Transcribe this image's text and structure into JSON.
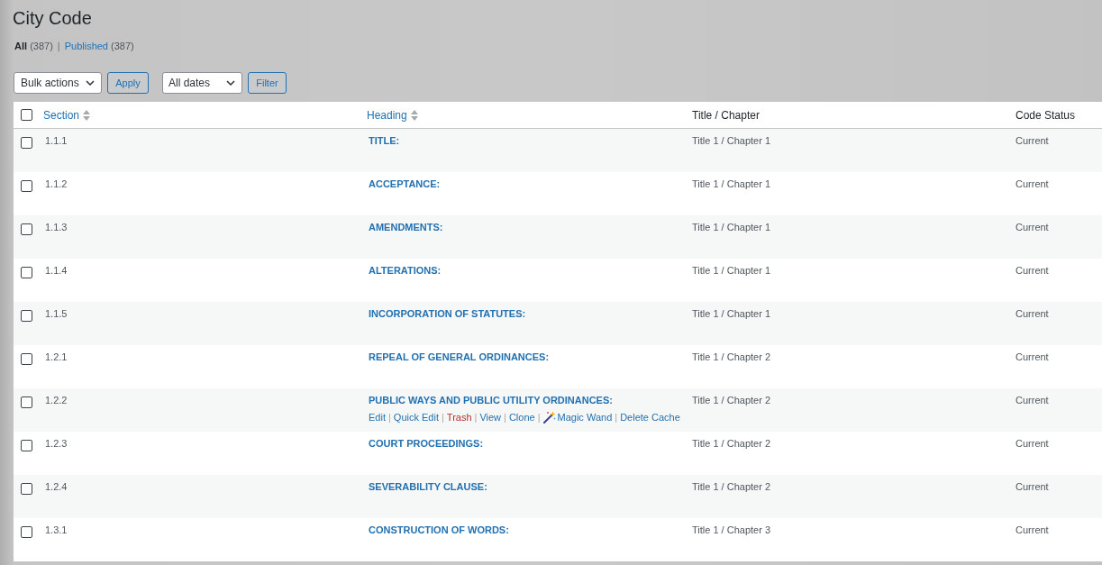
{
  "page": {
    "title": "City Code"
  },
  "filters": {
    "separator": "|",
    "items": [
      {
        "label": "All",
        "count": "(387)",
        "selected": true
      },
      {
        "label": "Published",
        "count": "(387)",
        "selected": false
      }
    ]
  },
  "toolbar": {
    "bulk_actions": {
      "value": "Bulk actions"
    },
    "apply_button": "Apply",
    "date_filter": {
      "value": "All dates"
    },
    "filter_button": "Filter"
  },
  "table": {
    "select_all_checked": false,
    "columns": [
      {
        "label": "Section",
        "sortable": true
      },
      {
        "label": "Heading",
        "sortable": true
      },
      {
        "label": "Title / Chapter",
        "sortable": false
      },
      {
        "label": "Code Status",
        "sortable": false
      }
    ],
    "rows": [
      {
        "checked": false,
        "section": "1.1.1",
        "heading": "TITLE:",
        "title_chapter": "Title 1 / Chapter 1",
        "code_status": "Current"
      },
      {
        "checked": false,
        "section": "1.1.2",
        "heading": "ACCEPTANCE:",
        "title_chapter": "Title 1 / Chapter 1",
        "code_status": "Current"
      },
      {
        "checked": false,
        "section": "1.1.3",
        "heading": "AMENDMENTS:",
        "title_chapter": "Title 1 / Chapter 1",
        "code_status": "Current"
      },
      {
        "checked": false,
        "section": "1.1.4",
        "heading": "ALTERATIONS:",
        "title_chapter": "Title 1 / Chapter 1",
        "code_status": "Current"
      },
      {
        "checked": false,
        "section": "1.1.5",
        "heading": "INCORPORATION OF STATUTES:",
        "title_chapter": "Title 1 / Chapter 1",
        "code_status": "Current"
      },
      {
        "checked": false,
        "section": "1.2.1",
        "heading": "REPEAL OF GENERAL ORDINANCES:",
        "title_chapter": "Title 1 / Chapter 2",
        "code_status": "Current"
      },
      {
        "checked": false,
        "section": "1.2.2",
        "heading": "PUBLIC WAYS AND PUBLIC UTILITY ORDINANCES:",
        "title_chapter": "Title 1 / Chapter 2",
        "code_status": "Current",
        "actions": {
          "separator": "|",
          "items": [
            {
              "label": "Edit",
              "kind": "link"
            },
            {
              "label": "Quick Edit",
              "kind": "link"
            },
            {
              "label": "Trash",
              "kind": "danger"
            },
            {
              "label": "View",
              "kind": "link"
            },
            {
              "label": "Clone",
              "kind": "link"
            },
            {
              "label": "Magic Wand",
              "kind": "wand"
            },
            {
              "label": "Delete Cache",
              "kind": "link"
            }
          ]
        }
      },
      {
        "checked": false,
        "section": "1.2.3",
        "heading": "COURT PROCEEDINGS:",
        "title_chapter": "Title 1 / Chapter 2",
        "code_status": "Current"
      },
      {
        "checked": false,
        "section": "1.2.4",
        "heading": "SEVERABILITY CLAUSE:",
        "title_chapter": "Title 1 / Chapter 2",
        "code_status": "Current"
      },
      {
        "checked": false,
        "section": "1.3.1",
        "heading": "CONSTRUCTION OF WORDS:",
        "title_chapter": "Title 1 / Chapter 3",
        "code_status": "Current"
      }
    ]
  }
}
